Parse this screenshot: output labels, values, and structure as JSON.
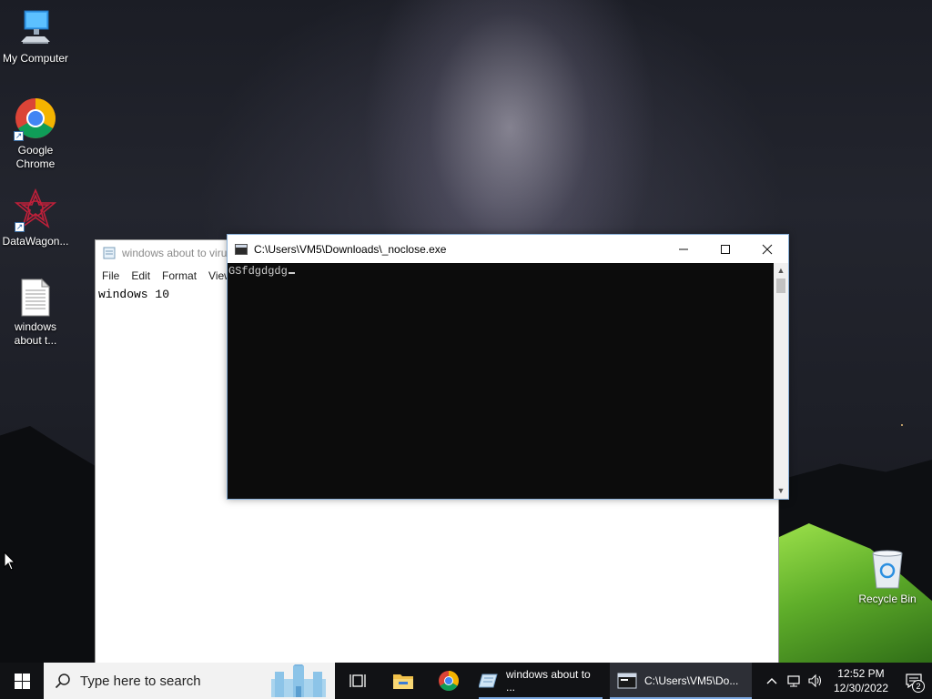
{
  "desktop": {
    "icons": [
      {
        "label": "My Computer",
        "icon": "computer-icon"
      },
      {
        "label": "Google Chrome",
        "icon": "chrome-icon"
      },
      {
        "label": "DataWagon...",
        "icon": "datawagon-icon"
      },
      {
        "label": "windows about t...",
        "icon": "text-file-icon"
      },
      {
        "label": "Recycle Bin",
        "icon": "recycle-bin-icon"
      }
    ]
  },
  "notepad": {
    "title": "windows about to virus",
    "menu": [
      "File",
      "Edit",
      "Format",
      "View"
    ],
    "content": "windows 10"
  },
  "console": {
    "title": "C:\\Users\\VM5\\Downloads\\_noclose.exe",
    "output": "GSfdgdgdg",
    "controls": {
      "minimize": "—",
      "maximize": "☐",
      "close": "✕"
    }
  },
  "taskbar": {
    "search_placeholder": "Type here to search",
    "apps": [
      {
        "label": "windows about to ...",
        "icon": "notepad-icon",
        "active": false
      },
      {
        "label": "C:\\Users\\VM5\\Do...",
        "icon": "console-icon",
        "active": true
      }
    ],
    "clock": {
      "time": "12:52 PM",
      "date": "12/30/2022"
    },
    "notification_count": "2"
  },
  "colors": {
    "taskbar": "#111215",
    "console_bg": "#0c0c0c",
    "accent": "#7aa7e0"
  }
}
